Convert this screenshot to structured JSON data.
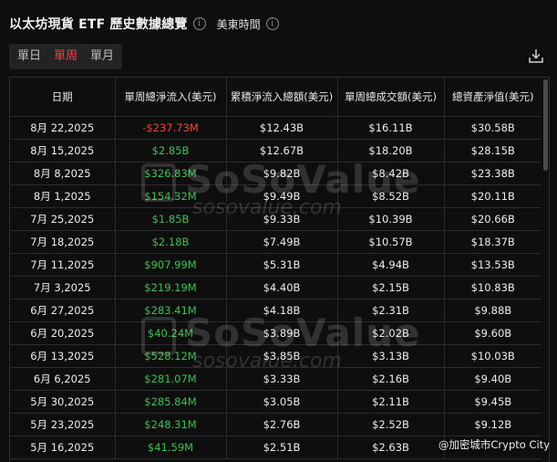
{
  "header": {
    "title": "以太坊現貨 ETF 歷史數據總覽",
    "timezone": "美東時間",
    "info_glyph": "i"
  },
  "tabs": [
    "單日",
    "單周",
    "單月"
  ],
  "active_tab": "單周",
  "columns": [
    "日期",
    "單周總淨流入(美元)",
    "累積淨流入總額(美元)",
    "單周總成交額(美元)",
    "總資產淨值(美元)"
  ],
  "rows": [
    {
      "date": "8月 22,2025",
      "net": "-$237.73M",
      "cum": "$12.43B",
      "vol": "$16.11B",
      "nav": "$30.58B",
      "dir": "neg"
    },
    {
      "date": "8月 15,2025",
      "net": "$2.85B",
      "cum": "$12.67B",
      "vol": "$18.20B",
      "nav": "$28.15B",
      "dir": "pos"
    },
    {
      "date": "8月 8,2025",
      "net": "$326.83M",
      "cum": "$9.82B",
      "vol": "$8.42B",
      "nav": "$23.38B",
      "dir": "pos"
    },
    {
      "date": "8月 1,2025",
      "net": "$154.32M",
      "cum": "$9.49B",
      "vol": "$8.52B",
      "nav": "$20.11B",
      "dir": "pos"
    },
    {
      "date": "7月 25,2025",
      "net": "$1.85B",
      "cum": "$9.33B",
      "vol": "$10.39B",
      "nav": "$20.66B",
      "dir": "pos"
    },
    {
      "date": "7月 18,2025",
      "net": "$2.18B",
      "cum": "$7.49B",
      "vol": "$10.57B",
      "nav": "$18.37B",
      "dir": "pos"
    },
    {
      "date": "7月 11,2025",
      "net": "$907.99M",
      "cum": "$5.31B",
      "vol": "$4.94B",
      "nav": "$13.53B",
      "dir": "pos"
    },
    {
      "date": "7月 3,2025",
      "net": "$219.19M",
      "cum": "$4.40B",
      "vol": "$2.15B",
      "nav": "$10.83B",
      "dir": "pos"
    },
    {
      "date": "6月 27,2025",
      "net": "$283.41M",
      "cum": "$4.18B",
      "vol": "$2.31B",
      "nav": "$9.88B",
      "dir": "pos"
    },
    {
      "date": "6月 20,2025",
      "net": "$40.24M",
      "cum": "$3.89B",
      "vol": "$2.02B",
      "nav": "$9.60B",
      "dir": "pos"
    },
    {
      "date": "6月 13,2025",
      "net": "$528.12M",
      "cum": "$3.85B",
      "vol": "$3.13B",
      "nav": "$10.03B",
      "dir": "pos"
    },
    {
      "date": "6月 6,2025",
      "net": "$281.07M",
      "cum": "$3.33B",
      "vol": "$2.16B",
      "nav": "$9.40B",
      "dir": "pos"
    },
    {
      "date": "5月 30,2025",
      "net": "$285.84M",
      "cum": "$3.05B",
      "vol": "$2.11B",
      "nav": "$9.45B",
      "dir": "pos"
    },
    {
      "date": "5月 23,2025",
      "net": "$248.31M",
      "cum": "$2.76B",
      "vol": "$2.52B",
      "nav": "$9.12B",
      "dir": "pos"
    },
    {
      "date": "5月 16,2025",
      "net": "$41.59M",
      "cum": "$2.51B",
      "vol": "$2.63B",
      "nav": "",
      "dir": "pos"
    }
  ],
  "watermark": {
    "brand": "SoSoValue",
    "site": "sosovalue.com"
  },
  "credit": "@加密城市Crypto City",
  "colors": {
    "positive": "#3ac24f",
    "negative": "#f0443a",
    "active_tab": "#e5483f"
  }
}
